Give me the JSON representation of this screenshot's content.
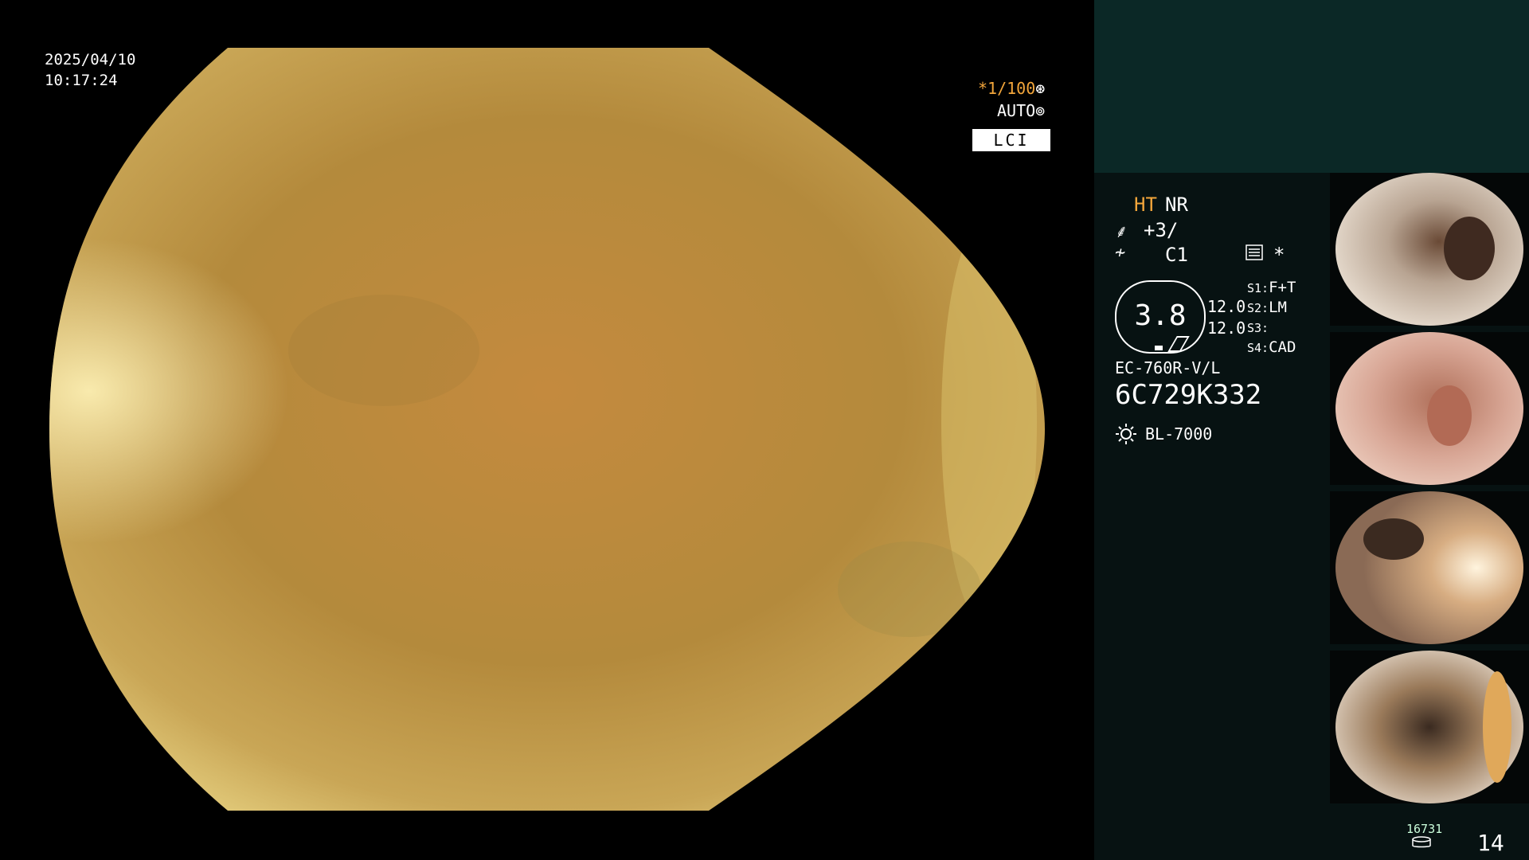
{
  "overlay": {
    "date": "2025/04/10",
    "time": "10:17:24",
    "shutter": "*1/100",
    "shutter_icon": "aperture-icon",
    "iris": "AUTO",
    "iris_icon": "iris-icon",
    "mode": "LCI"
  },
  "settings": {
    "ht": "HT",
    "nr": "NR",
    "enhance_icon": "structure-enhance-icon",
    "enhance": "+3/",
    "color_icon": "color-mode-icon",
    "color": "C1",
    "menu_icon": "settings-list-icon",
    "star": "*",
    "pressure": "3.8",
    "value_top": "12.0",
    "value_bottom": "12.0"
  },
  "switches": [
    {
      "key": "S1:",
      "value": "F+T"
    },
    {
      "key": "S2:",
      "value": "LM"
    },
    {
      "key": "S3:",
      "value": ""
    },
    {
      "key": "S4:",
      "value": "CAD"
    }
  ],
  "device": {
    "model": "EC-760R-V/L",
    "serial": "6C729K332",
    "light_icon": "light-source-icon",
    "light_source": "BL-7000"
  },
  "thumbnails": [
    {
      "label": "captured-image-1"
    },
    {
      "label": "captured-image-2"
    },
    {
      "label": "captured-image-3"
    },
    {
      "label": "captured-image-4"
    }
  ],
  "footer": {
    "image_count": "16731",
    "storage_icon": "storage-disk-icon",
    "page": "14"
  },
  "colors": {
    "accent_orange": "#f3a63b",
    "panel_teal": "#0b2826",
    "panel_dark": "#071212"
  }
}
